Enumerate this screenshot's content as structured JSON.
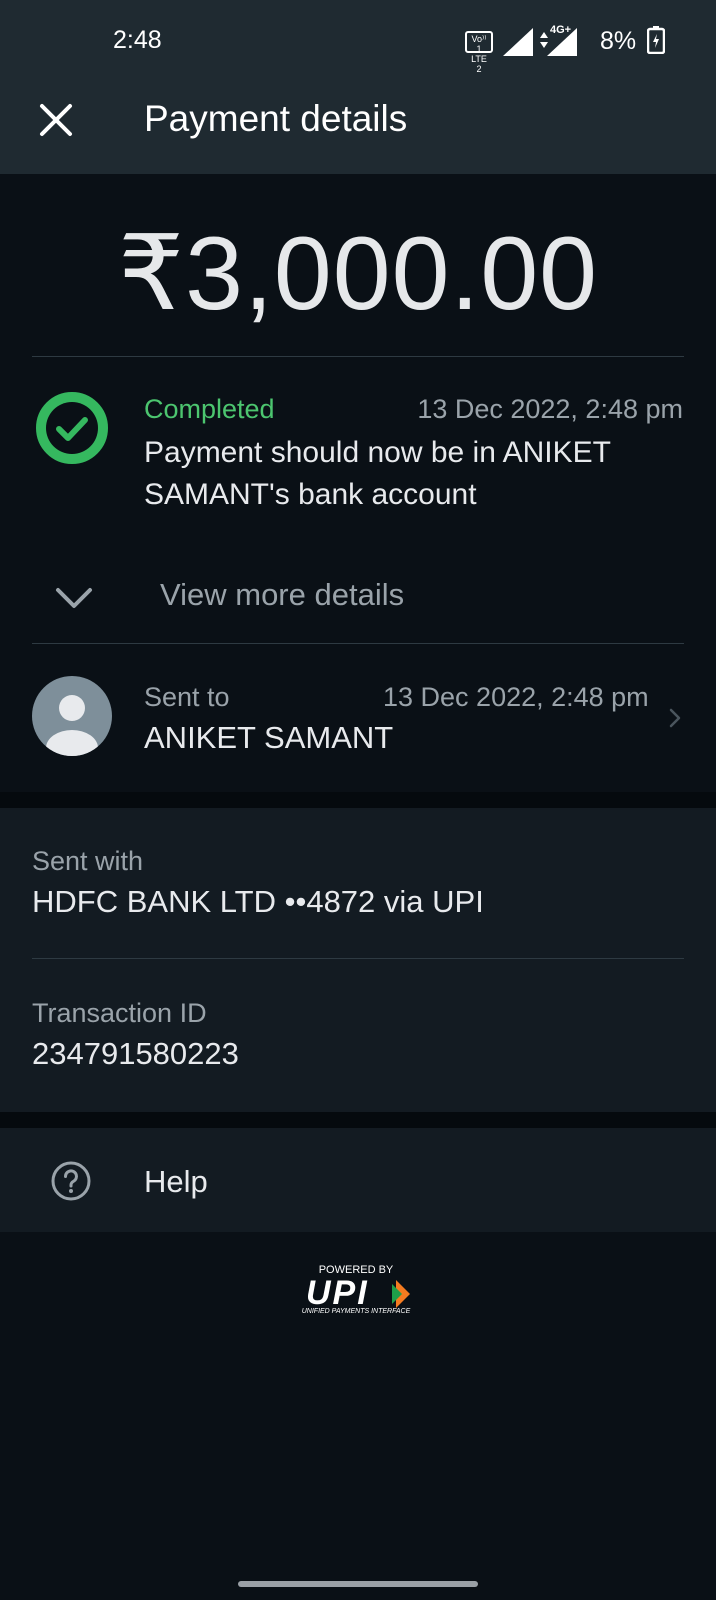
{
  "status_bar": {
    "time": "2:48",
    "volte_line1": "Vo⁾⁾ 1",
    "volte_line2": "LTE 2",
    "network": "4G+",
    "battery": "8%"
  },
  "header": {
    "title": "Payment details",
    "close_icon": "close-icon"
  },
  "payment": {
    "amount": "₹3,000.00",
    "status": "Completed",
    "status_color": "#4cc56f",
    "timestamp": "13 Dec 2022, 2:48 pm",
    "message": "Payment should now be in ANIKET SAMANT's bank account",
    "view_more_label": "View more details"
  },
  "recipient": {
    "label": "Sent to",
    "timestamp": "13 Dec 2022, 2:48 pm",
    "name": "ANIKET SAMANT"
  },
  "details": {
    "sent_with_label": "Sent with",
    "sent_with_value": "HDFC BANK LTD ••4872 via UPI",
    "transaction_id_label": "Transaction ID",
    "transaction_id_value": "234791580223"
  },
  "help": {
    "label": "Help",
    "icon": "help-circle-icon"
  },
  "footer": {
    "powered_by": "POWERED BY",
    "brand": "UPI",
    "brand_subtitle": "UNIFIED PAYMENTS INTERFACE"
  }
}
